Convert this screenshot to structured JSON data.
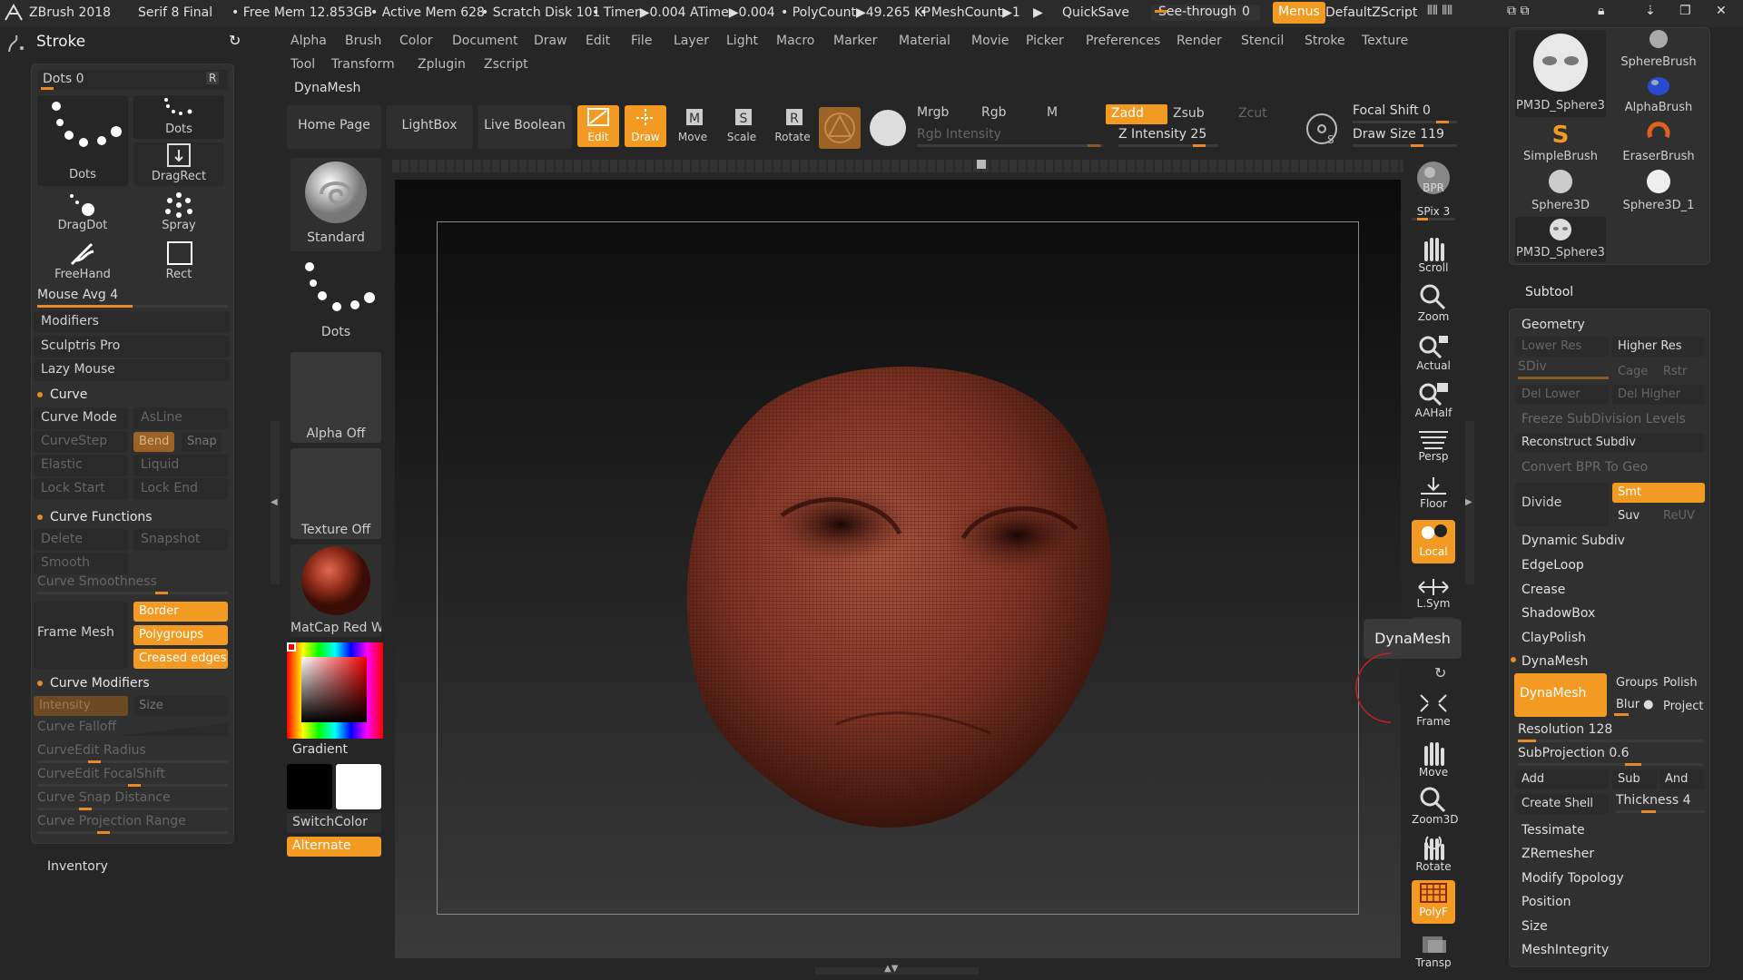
{
  "title": {
    "app": "ZBrush 2018",
    "version": "Serif 8 Final",
    "free_mem": "• Free Mem 12.853GB",
    "active_mem": "• Active Mem 628",
    "scratch": "• Scratch Disk 101",
    "timer": "• Timer▶0.004 ATime▶0.004",
    "polycount": "• PolyCount▶49.265 KP",
    "meshcount": "• MeshCount▶1",
    "play": "▶",
    "quicksave": "QuickSave",
    "seethrough": "See-through",
    "seethrough_val": "0",
    "menus": "Menus",
    "script": "DefaultZScript"
  },
  "menu_row1": [
    "Alpha",
    "Brush",
    "Color",
    "Document",
    "Draw",
    "Edit",
    "File",
    "Layer",
    "Light",
    "Macro",
    "Marker",
    "Material",
    "Movie",
    "Picker",
    "Preferences",
    "Render",
    "Stencil",
    "Stroke",
    "Texture"
  ],
  "menu_row2": [
    "Tool",
    "Transform",
    "Zplugin",
    "Zscript"
  ],
  "left": {
    "title": "Stroke",
    "dots": "Dots 0",
    "r": "R",
    "strokes": [
      "Dots",
      "Dots",
      "DragRect",
      "DragDot",
      "Spray",
      "FreeHand",
      "Rect"
    ],
    "mouse_avg": "Mouse Avg 4",
    "items": [
      "Modifiers",
      "Sculptris Pro",
      "Lazy Mouse"
    ],
    "curve": "Curve",
    "curve_mode": "Curve Mode",
    "asline": "AsLine",
    "curvestep": "CurveStep",
    "bend": "Bend",
    "snap": "Snap",
    "elastic": "Elastic",
    "liquid": "Liquid",
    "lock_start": "Lock Start",
    "lock_end": "Lock End",
    "curve_functions": "Curve Functions",
    "delete": "Delete",
    "snapshot": "Snapshot",
    "smooth": "Smooth",
    "curve_smoothness": "Curve Smoothness",
    "frame_mesh": "Frame Mesh",
    "border": "Border",
    "polygroups": "Polygroups",
    "creased": "Creased edges",
    "curve_modifiers": "Curve Modifiers",
    "intensity": "Intensity",
    "size": "Size",
    "falloff": "Curve Falloff",
    "edit_radius": "CurveEdit Radius",
    "edit_focal": "CurveEdit FocalShift",
    "snap_dist": "Curve Snap Distance",
    "proj_range": "Curve Projection Range",
    "inventory": "Inventory"
  },
  "shelf": {
    "dynamesh": "DynaMesh",
    "home": "Home Page",
    "lightbox": "LightBox",
    "liveboolean": "Live Boolean",
    "edit": "Edit",
    "draw": "Draw",
    "move": "Move",
    "scale": "Scale",
    "rotate": "Rotate",
    "mrgb": "Mrgb",
    "rgb": "Rgb",
    "m": "M",
    "zadd": "Zadd",
    "zsub": "Zsub",
    "zcut": "Zcut",
    "rgb_intensity": "Rgb Intensity",
    "z_intensity": "Z Intensity 25",
    "focal_shift": "Focal Shift 0",
    "draw_size": "Draw Size 119"
  },
  "palette": {
    "standard": "Standard",
    "dots": "Dots",
    "alpha": "Alpha Off",
    "texture": "Texture Off",
    "matcap": "MatCap Red W",
    "gradient": "Gradient",
    "switchcolor": "SwitchColor",
    "alternate": "Alternate"
  },
  "right_tools": [
    "BPR",
    "SPix 3",
    "Scroll",
    "Zoom",
    "Actual",
    "AAHalf",
    "Persp",
    "Floor",
    "Local",
    "L.Sym",
    "Frame",
    "Move",
    "Zoom3D",
    "Rotate",
    "PolyF",
    "Transp"
  ],
  "tooltip": "DynaMesh",
  "tool_thumbs": [
    "SphereBrush",
    "PM3D_Sphere3",
    "AlphaBrush",
    "SimpleBrush",
    "EraserBrush",
    "Sphere3D",
    "Sphere3D_1",
    "PM3D_Sphere3"
  ],
  "subtool": {
    "subtool": "Subtool",
    "geometry": "Geometry",
    "lower_res": "Lower Res",
    "higher_res": "Higher Res",
    "sdiv": "SDiv",
    "cage": "Cage",
    "rstr": "Rstr",
    "del_lower": "Del Lower",
    "del_higher": "Del Higher",
    "freeze": "Freeze SubDivision Levels",
    "reconstruct": "Reconstruct Subdiv",
    "convert": "Convert BPR To Geo",
    "divide": "Divide",
    "smt": "Smt",
    "suv": "Suv",
    "reuv": "ReUV",
    "items": [
      "Dynamic Subdiv",
      "EdgeLoop",
      "Crease",
      "ShadowBox",
      "ClayPolish"
    ],
    "dynamesh": "DynaMesh",
    "dynamesh_btn": "DynaMesh",
    "groups": "Groups",
    "polish": "Polish",
    "blur": "Blur",
    "project": "Project",
    "resolution": "Resolution 128",
    "subprojection": "SubProjection 0.6",
    "add": "Add",
    "sub": "Sub",
    "and": "And",
    "create_shell": "Create Shell",
    "thickness": "Thickness 4",
    "bottom": [
      "Tessimate",
      "ZRemesher",
      "Modify Topology",
      "Position",
      "Size",
      "MeshIntegrity"
    ]
  },
  "colors": {
    "accent": "#f39a22",
    "bg": "#262626",
    "panel": "#303030"
  }
}
